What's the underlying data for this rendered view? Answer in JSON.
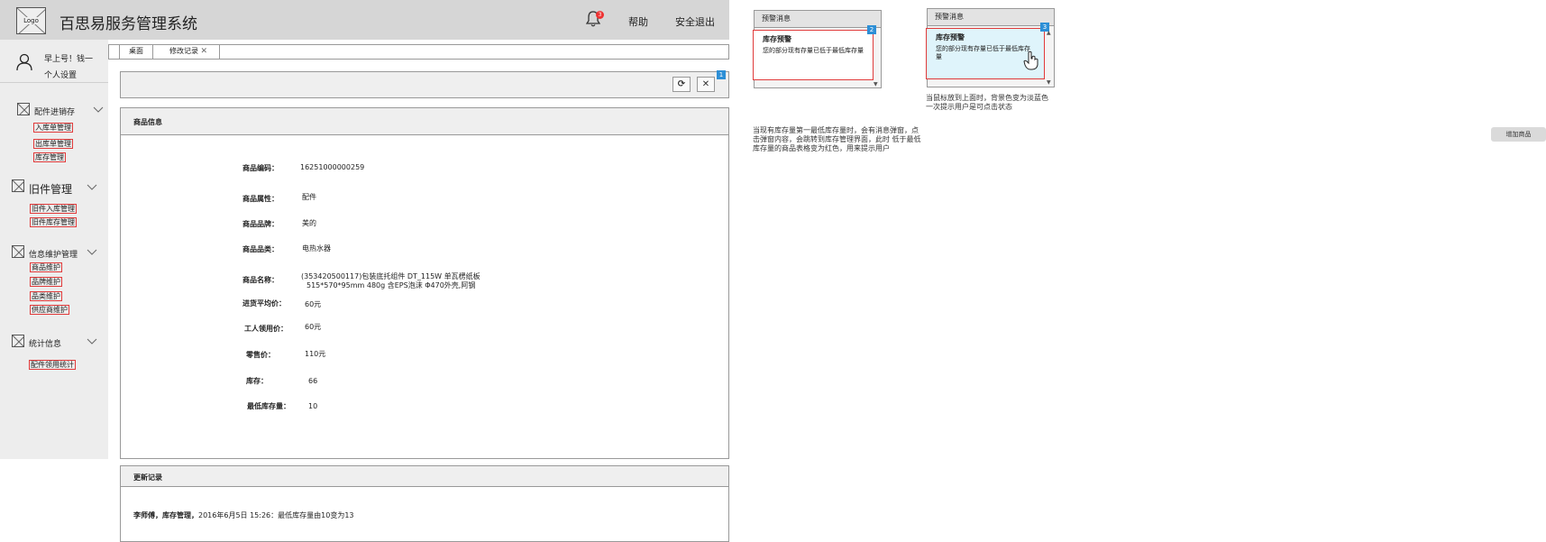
{
  "header": {
    "logo_text": "Logo",
    "title": "百思易服务管理系统",
    "bell_badge": "3",
    "help": "帮助",
    "logout": "安全退出"
  },
  "user": {
    "greeting": "早上号！钱一",
    "settings": "个人设置"
  },
  "sidebar": {
    "groups": [
      {
        "title": "配件进销存",
        "items": [
          "入库单管理",
          "出库单管理",
          "库存管理"
        ]
      },
      {
        "title": "旧件管理",
        "items": [
          "旧件入库管理",
          "旧件库存管理"
        ]
      },
      {
        "title": "信息维护管理",
        "items": [
          "商品维护",
          "品牌维护",
          "品类维护",
          "供应商维护"
        ]
      },
      {
        "title": "统计信息",
        "items": [
          "配件领用统计"
        ]
      }
    ]
  },
  "tabs": [
    {
      "label": "桌面"
    },
    {
      "label": "修改记录"
    }
  ],
  "toolbar": {
    "refresh_icon": "⟳",
    "close_icon": "✕",
    "badge": "1"
  },
  "product": {
    "title": "商品信息",
    "fields": [
      {
        "label": "商品编码：",
        "value": "16251000000259"
      },
      {
        "label": "商品属性：",
        "value": "配件"
      },
      {
        "label": "商品品牌：",
        "value": "美的"
      },
      {
        "label": "商品品类：",
        "value": "电热水器"
      },
      {
        "label": "商品名称：",
        "value": "(353420500117)包装底托组件 DT_115W 单瓦楞纸板",
        "value2": "515*570*95mm 480g 含EPS泡沫 Φ470外壳,阿钢"
      },
      {
        "label": "进货平均价：",
        "value": "60元"
      },
      {
        "label": "工人领用价：",
        "value": "60元"
      },
      {
        "label": "零售价：",
        "value": "110元"
      },
      {
        "label": "库存：",
        "value": "66"
      },
      {
        "label": "最低库存量：",
        "value": "10"
      }
    ]
  },
  "updates": {
    "title": "更新记录",
    "log_bold": "李师傅，库存管理，",
    "log_rest": "2016年6月5日 15:26：最低库存量由10变为13"
  },
  "popup1": {
    "header": "预警消息",
    "card_title": "库存预警",
    "card_text": "您的部分现有存量已低于最低库存量",
    "badge": "2"
  },
  "popup2": {
    "header": "预警消息",
    "card_title": "库存预警",
    "card_text": "您的部分现有存量已低于最低库存量",
    "badge": "3"
  },
  "notes": {
    "hover": "当鼠标放到上面时，背景色变为淡蓝色一次提示用户是可点击状态",
    "description": "当现有库存量第一最低库存量时，会有消息弹窗，点击弹窗内容，会跳转到库存管理界面，此时 低于最低库存量的商品表格变为红色，用来提示用户"
  },
  "add_button": "增加商品",
  "colors": {
    "accent_red": "#e03a3a",
    "badge_blue": "#2d8fd6",
    "hover_blue": "#dff4fb"
  }
}
